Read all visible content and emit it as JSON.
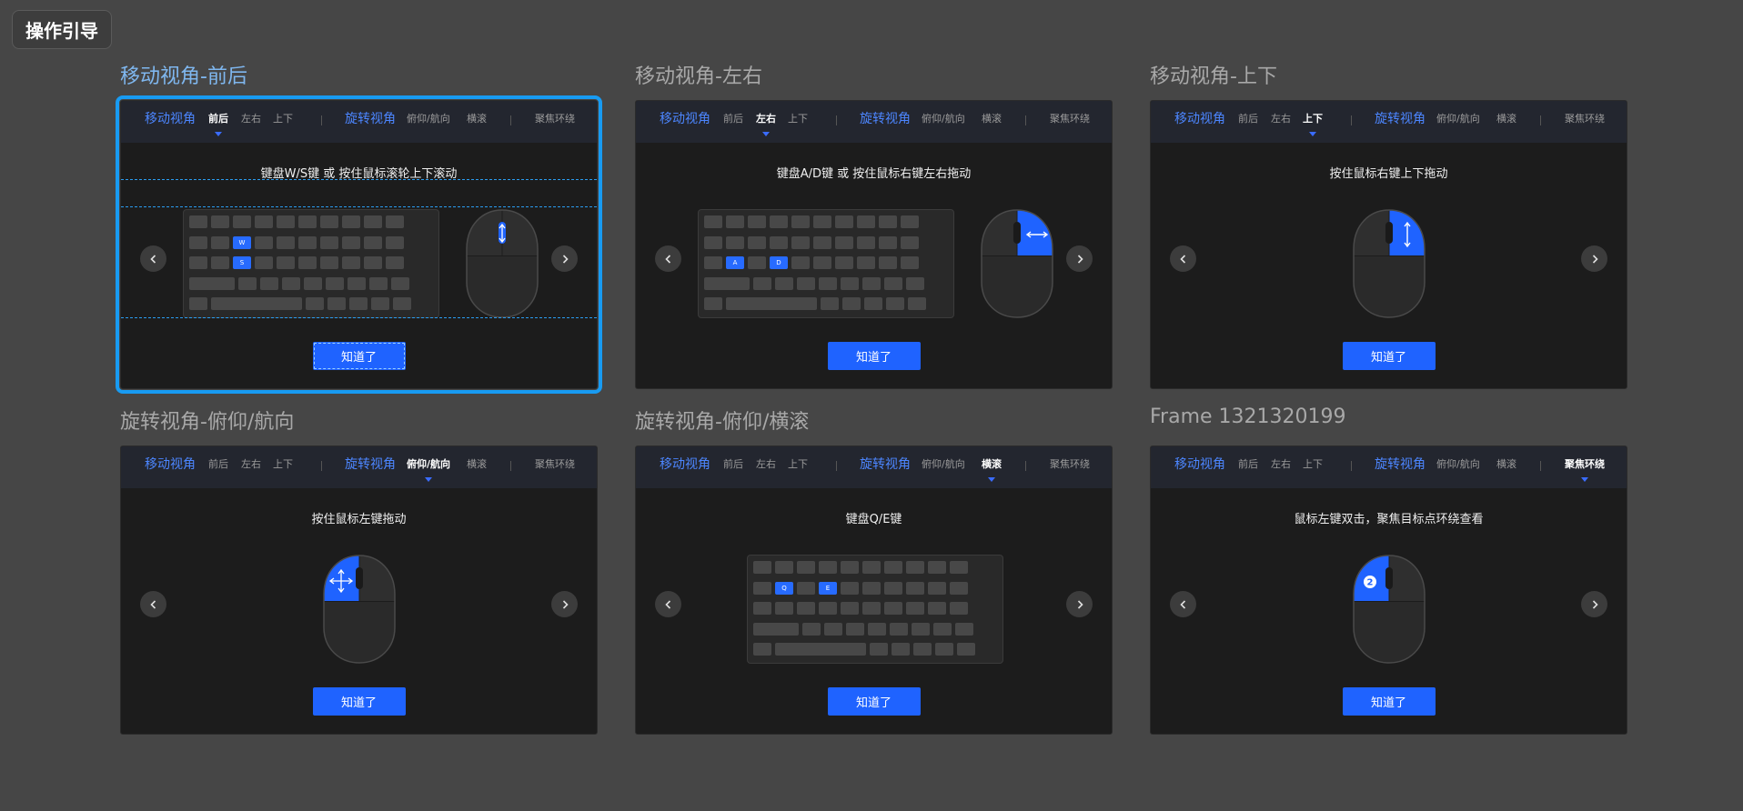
{
  "page_badge": "操作引导",
  "tabs": {
    "move_group": "移动视角",
    "forward": "前后",
    "left_right": "左右",
    "up_down": "上下",
    "rotate_group": "旋转视角",
    "pitch_yaw": "俯仰/航向",
    "roll": "横滚",
    "orbit": "聚焦环绕"
  },
  "confirm_label": "知道了",
  "colors": {
    "accent": "#1f63ff",
    "tab_active_arrow": "#3a6cff",
    "selection": "#189bf2"
  },
  "icons": {
    "prev": "chevron-left-icon",
    "next": "chevron-right-icon"
  },
  "frames": [
    {
      "title": "移动视角-前后",
      "active_tab": "forward",
      "instruction": "键盘W/S键 或 按住鼠标滚轮上下滚动",
      "keys": [
        "W",
        "S"
      ]
    },
    {
      "title": "移动视角-左右",
      "active_tab": "left_right",
      "instruction": "键盘A/D键 或 按住鼠标右键左右拖动",
      "keys": [
        "A",
        "D"
      ]
    },
    {
      "title": "移动视角-上下",
      "active_tab": "up_down",
      "instruction": "按住鼠标右键上下拖动"
    },
    {
      "title": "旋转视角-俯仰/航向",
      "active_tab": "pitch_yaw",
      "instruction": "按住鼠标左键拖动"
    },
    {
      "title": "旋转视角-俯仰/横滚",
      "active_tab": "roll",
      "instruction": "键盘Q/E键",
      "keys": [
        "Q",
        "E"
      ]
    },
    {
      "title": "Frame 1321320199",
      "active_tab": "orbit",
      "instruction": "鼠标左键双击，聚焦目标点环绕查看",
      "badge": "2"
    }
  ]
}
